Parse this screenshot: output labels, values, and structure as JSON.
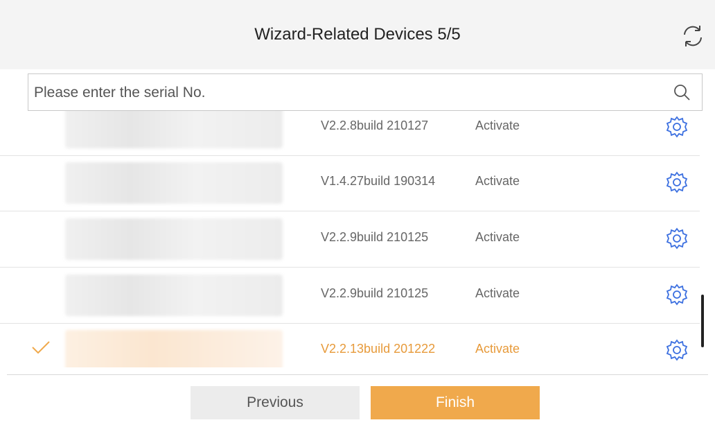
{
  "header": {
    "title": "Wizard-Related Devices 5/5",
    "refresh_icon": "refresh-icon"
  },
  "search": {
    "placeholder": "Please enter the serial No.",
    "icon": "search-icon"
  },
  "devices": [
    {
      "version": "V2.2.8build 210127",
      "status": "Activate",
      "selected": false
    },
    {
      "version": "V1.4.27build 190314",
      "status": "Activate",
      "selected": false
    },
    {
      "version": "V2.2.9build 210125",
      "status": "Activate",
      "selected": false
    },
    {
      "version": "V2.2.9build 210125",
      "status": "Activate",
      "selected": false
    },
    {
      "version": "V2.2.13build 201222",
      "status": "Activate",
      "selected": true
    }
  ],
  "footer": {
    "previous_label": "Previous",
    "finish_label": "Finish"
  },
  "colors": {
    "accent": "#f0a94c",
    "selected_text": "#e79a3a",
    "gear_icon": "#3b6fe0"
  }
}
